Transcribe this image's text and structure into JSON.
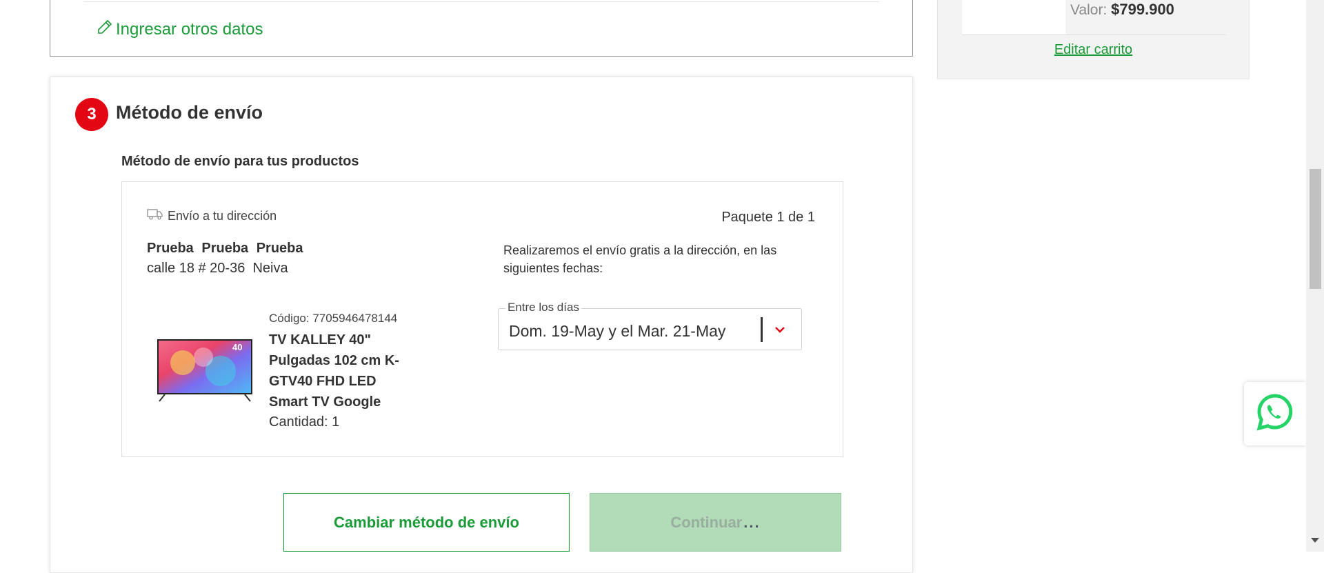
{
  "address_section": {
    "other_data_link": "Ingresar otros datos"
  },
  "cart_summary": {
    "value_label": "Valor:",
    "value_amount": "$799.900",
    "edit_cart_link": "Editar carrito"
  },
  "shipping": {
    "step_number": "3",
    "title": "Método de envío",
    "subtitle": "Método de envío para tus productos",
    "package": {
      "ship_type": "Envío a tu dirección",
      "package_count": "Paquete 1 de 1",
      "recipient": "Prueba  Prueba Prueba",
      "address": "calle 18 # 20-36  Neiva",
      "product": {
        "code": "Código: 7705946478144",
        "name": "TV KALLEY 40\" Pulgadas 102 cm K-GTV40 FHD LED Smart TV Google",
        "quantity": "Cantidad: 1",
        "image_badge": "40"
      },
      "ship_note": "Realizaremos el envío gratis a la dirección, en las siguientes fechas:",
      "date_select": {
        "legend": "Entre los días",
        "value": "Dom. 19-May y el Mar. 21-May"
      }
    },
    "buttons": {
      "change_method": "Cambiar método de envío",
      "continue": "Continuar",
      "continue_dots": "..."
    }
  },
  "colors": {
    "brand_green": "#1a9b38",
    "brand_red": "#e30613",
    "disabled_green": "#b2dbb7",
    "whatsapp_green": "#25d366"
  },
  "icons": {
    "edit": "pencil-icon",
    "ship": "truck-icon",
    "dropdown": "chevron-down-icon",
    "whatsapp": "whatsapp-icon"
  }
}
